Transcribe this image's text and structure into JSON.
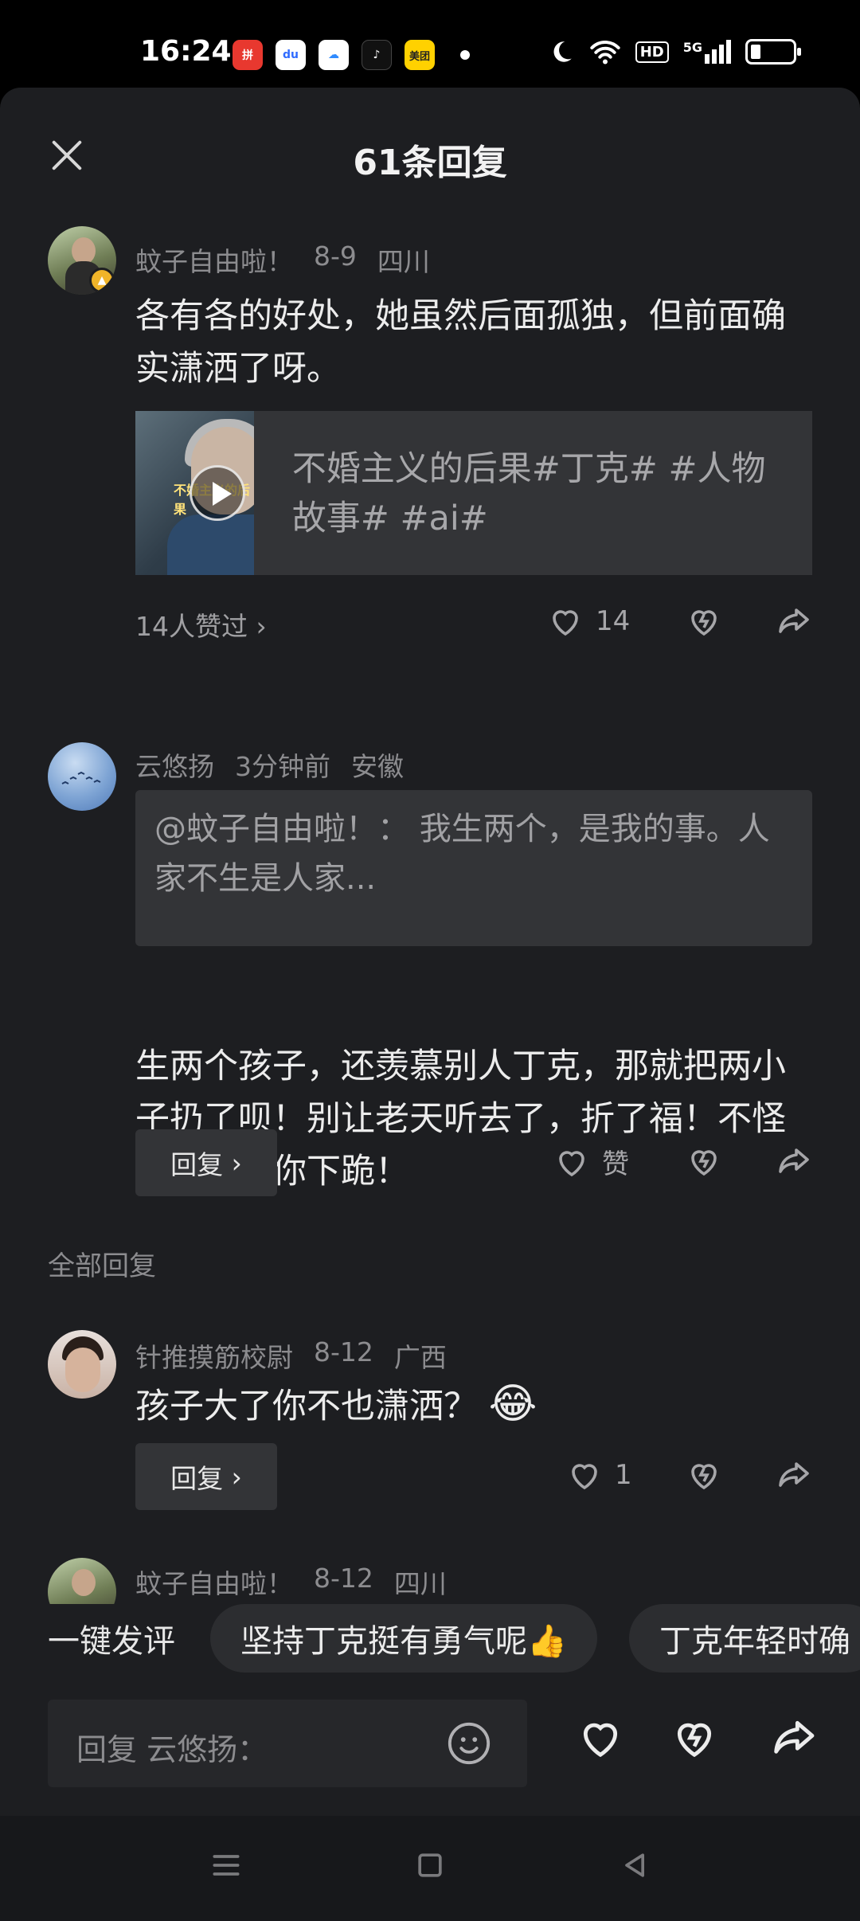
{
  "status_bar": {
    "time": "16:24",
    "apps": [
      {
        "icon": "pinduoduo-icon",
        "color": "#e8382f",
        "text": "拼"
      },
      {
        "icon": "baidu-icon",
        "color": "#ffffff",
        "text": "du"
      },
      {
        "icon": "baidu-netdisk-icon",
        "color": "#ffffff",
        "text": "☁"
      },
      {
        "icon": "tiktok-icon",
        "color": "#ffffff",
        "text": "♪"
      },
      {
        "icon": "meituan-icon",
        "color": "#ffd100",
        "text": "美团"
      }
    ],
    "network": "5G",
    "hd_label": "HD"
  },
  "header": {
    "title": "61条回复"
  },
  "main_comment": {
    "username": "蚊子自由啦！",
    "date": "8-9",
    "location": "四川",
    "text": "各有各的好处，她虽然后面孤独，但前面确实潇洒了呀。",
    "video": {
      "title": "不婚主义的后果#丁克# #人物故事# #ai#",
      "thumb_caption": "不婚主义的后果"
    },
    "likers": "14人赞过",
    "like_count": "14"
  },
  "reply_comment": {
    "username": "云悠扬",
    "time": "3分钟前",
    "location": "安徽",
    "quote": "@蚊子自由啦！： 我生两个，是我的事。人家不生是人家...",
    "text": "生两个孩子，还羡慕别人丁克，那就把两小子扔了呗！别让老天听去了，折了福！不怪你婆婆给你下跪！",
    "reply_label": "回复",
    "like_label": "赞"
  },
  "section": {
    "all_replies": "全部回复"
  },
  "reply_2": {
    "username": "针推摸筋校尉",
    "date": "8-12",
    "location": "广西",
    "text": "孩子大了你不也潇洒？",
    "emoji": "😂",
    "reply_label": "回复",
    "like_count": "1"
  },
  "reply_3": {
    "username": "蚊子自由啦！",
    "date": "8-12",
    "location": "四川"
  },
  "quick_reply": {
    "label": "一键发评",
    "chips": [
      "坚持丁克挺有勇气呢👍",
      "丁克年轻时确"
    ]
  },
  "input": {
    "placeholder": "回复 云悠扬："
  },
  "colors": {
    "panel_bg": "#1d1e21",
    "card_bg": "#333437",
    "muted_text": "#8c8c8f"
  }
}
